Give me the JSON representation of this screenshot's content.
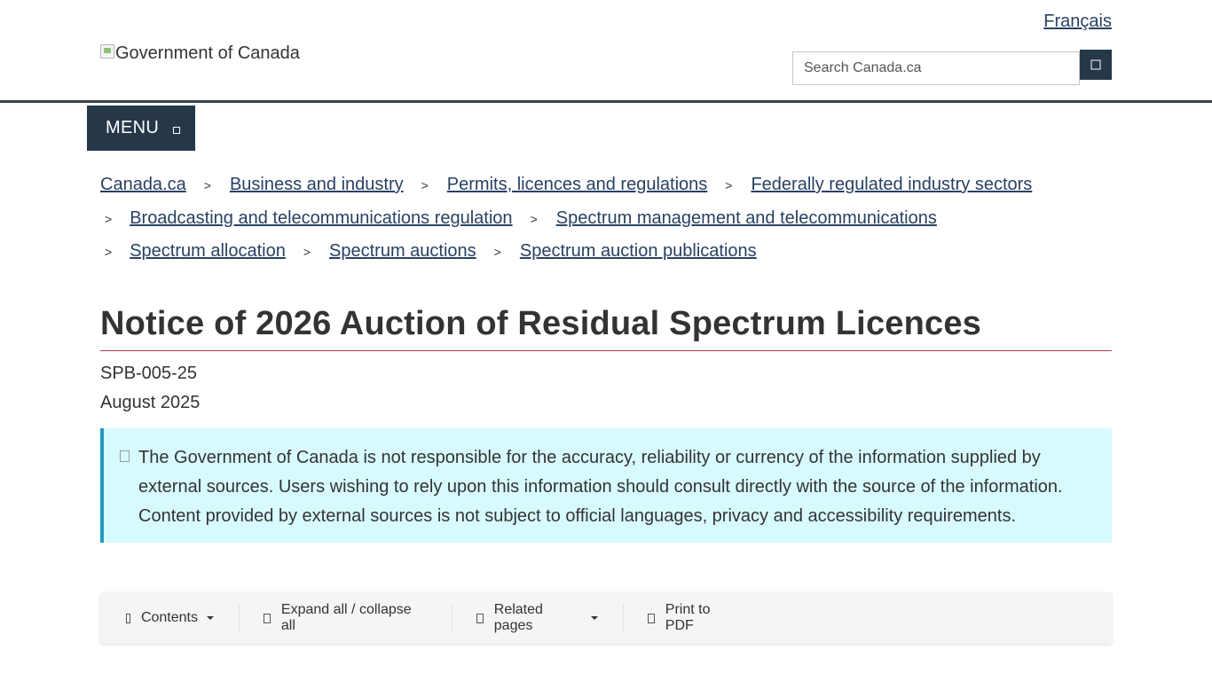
{
  "header": {
    "language_link": "Français",
    "logo_alt": "Government of Canada",
    "search": {
      "placeholder": "Search Canada.ca",
      "button_icon": "search-icon"
    }
  },
  "menu": {
    "label": "MENU",
    "icon": "chevron-down-icon"
  },
  "breadcrumb": {
    "separator": ">",
    "rows": [
      [
        "Canada.ca",
        "Business and industry",
        "Permits, licences and regulations",
        "Federally regulated industry sectors"
      ],
      [
        "Broadcasting and telecommunications regulation",
        "Spectrum management and telecommunications"
      ],
      [
        "Spectrum allocation",
        "Spectrum auctions",
        "Spectrum auction publications"
      ]
    ]
  },
  "page": {
    "title": "Notice of 2026 Auction of Residual Spectrum Licences",
    "document_number": "SPB-005-25",
    "date": "August 2025"
  },
  "notice": {
    "icon": "info-icon",
    "text": "The Government of Canada is not responsible for the accuracy, reliability or currency of the information supplied by external sources. Users wishing to rely upon this information should consult directly with the source of the information. Content provided by external sources is not subject to official languages, privacy and accessibility requirements."
  },
  "toolbar": {
    "items": [
      {
        "label": "Contents",
        "icon": "list-icon",
        "dropdown": true
      },
      {
        "label": "Expand all / collapse all",
        "icon": "expand-icon",
        "dropdown": false
      },
      {
        "label": "Related pages",
        "icon": "link-icon",
        "dropdown": true
      },
      {
        "label": "Print to PDF",
        "icon": "file-icon",
        "dropdown": false
      }
    ]
  },
  "colors": {
    "header_dark": "#26374a",
    "link": "#284162",
    "title_rule": "#af3c43",
    "notice_bg": "#d7faff",
    "notice_border": "#269abc",
    "toolbar_bg": "#f5f5f5"
  }
}
